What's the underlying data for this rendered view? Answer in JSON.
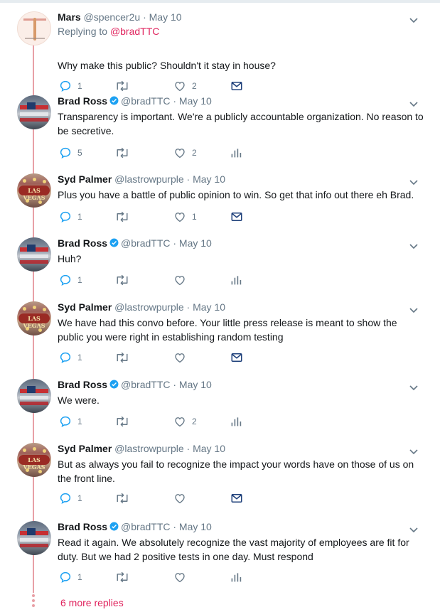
{
  "tweets": [
    {
      "name": "Mars",
      "handle": "@spencer2u",
      "date": "· May 10",
      "verified": false,
      "avatar": "mars",
      "replying_prefix": "Replying to",
      "replying_to": "@bradTTC",
      "text": "Why make this public? Shouldn't it stay in house?",
      "replies": "1",
      "retweets": "",
      "likes": "2",
      "extra_icon": "message-icon"
    },
    {
      "name": "Brad Ross",
      "handle": "@bradTTC",
      "date": "· May 10",
      "verified": true,
      "avatar": "brad",
      "text": "Transparency is important. We're a publicly accountable organization. No reason to be secretive.",
      "replies": "5",
      "retweets": "",
      "likes": "2",
      "extra_icon": "analytics-icon"
    },
    {
      "name": "Syd Palmer",
      "handle": "@lastrowpurple",
      "date": "· May 10",
      "verified": false,
      "avatar": "syd",
      "text": "Plus you have a battle of public opinion to win. So get that info out there eh Brad.",
      "replies": "1",
      "retweets": "",
      "likes": "1",
      "extra_icon": "message-icon"
    },
    {
      "name": "Brad Ross",
      "handle": "@bradTTC",
      "date": "· May 10",
      "verified": true,
      "avatar": "brad",
      "text": "Huh?",
      "replies": "1",
      "retweets": "",
      "likes": "",
      "extra_icon": "analytics-icon"
    },
    {
      "name": "Syd Palmer",
      "handle": "@lastrowpurple",
      "date": "· May 10",
      "verified": false,
      "avatar": "syd",
      "text": "We have had this convo before. Your little press release is meant to show the public you were right in establishing random testing",
      "replies": "1",
      "retweets": "",
      "likes": "",
      "extra_icon": "message-icon"
    },
    {
      "name": "Brad Ross",
      "handle": "@bradTTC",
      "date": "· May 10",
      "verified": true,
      "avatar": "brad",
      "text": "We were.",
      "replies": "1",
      "retweets": "",
      "likes": "2",
      "extra_icon": "analytics-icon"
    },
    {
      "name": "Syd Palmer",
      "handle": "@lastrowpurple",
      "date": "· May 10",
      "verified": false,
      "avatar": "syd",
      "text": "But as always you fail to recognize the impact your words have on those of us on the front line.",
      "replies": "1",
      "retweets": "",
      "likes": "",
      "extra_icon": "message-icon"
    },
    {
      "name": "Brad Ross",
      "handle": "@bradTTC",
      "date": "· May 10",
      "verified": true,
      "avatar": "brad",
      "text": "Read it again. We absolutely recognize the vast majority of employees are fit for duty. But we had 2 positive tests in one day. Must respond",
      "replies": "1",
      "retweets": "",
      "likes": "",
      "extra_icon": "analytics-icon"
    }
  ],
  "more_replies": "6 more replies",
  "avatar_labels": {
    "syd": "LAS VEGAS"
  },
  "colors": {
    "accent": "#e0245e",
    "thread_line": "#e8a0a6",
    "muted": "#657786",
    "verified": "#1da1f2"
  }
}
